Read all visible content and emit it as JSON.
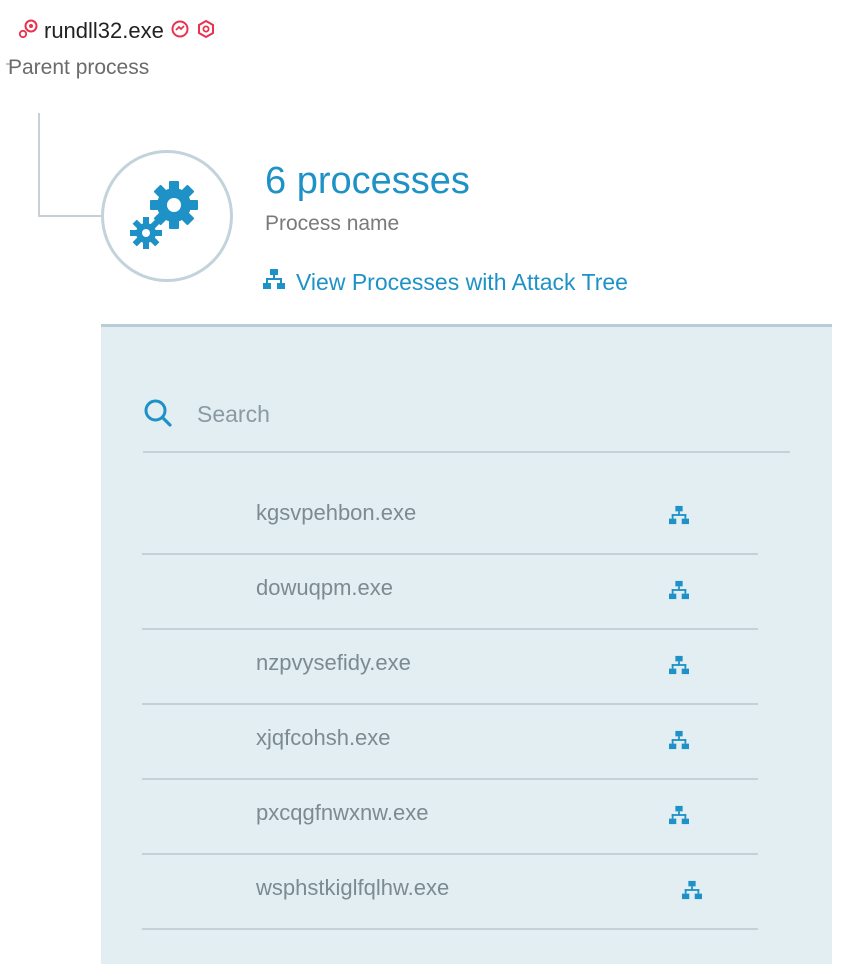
{
  "parent": {
    "name": "rundll32.exe",
    "label": "Parent process",
    "icon": "gears-icon",
    "status_icons": [
      "malop-icon",
      "suspicion-icon"
    ],
    "status_color": "#e8324e"
  },
  "processes": {
    "title": "6 processes",
    "subtitle": "Process name",
    "link_label": "View Processes with Attack Tree",
    "accent_color": "#1e92c7"
  },
  "search": {
    "placeholder": "Search",
    "value": ""
  },
  "items": [
    {
      "name": "kgsvpehbon.exe"
    },
    {
      "name": "dowuqpm.exe"
    },
    {
      "name": "nzpvysefidy.exe"
    },
    {
      "name": "xjqfcohsh.exe"
    },
    {
      "name": "pxcqgfnwxnw.exe"
    },
    {
      "name": "wsphstkiglfqlhw.exe"
    }
  ]
}
